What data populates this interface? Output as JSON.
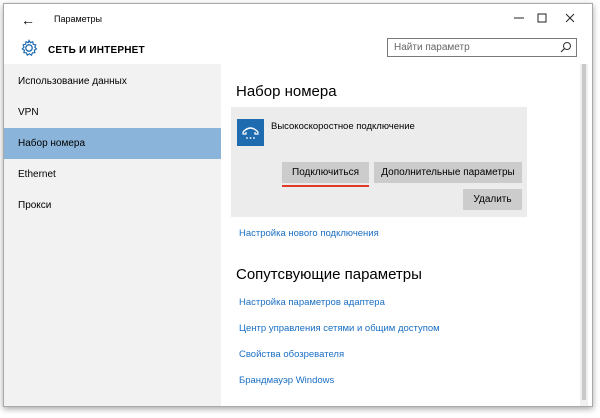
{
  "window": {
    "title": "Параметры",
    "back_glyph": "←",
    "minimize_glyph": "—",
    "maximize_glyph": "☐",
    "close_glyph": "✕"
  },
  "header": {
    "title": "СЕТЬ И ИНТЕРНЕТ",
    "search_placeholder": "Найти параметр"
  },
  "sidebar": {
    "items": [
      {
        "label": "Использование данных",
        "active": false
      },
      {
        "label": "VPN",
        "active": false
      },
      {
        "label": "Набор номера",
        "active": true
      },
      {
        "label": "Ethernet",
        "active": false
      },
      {
        "label": "Прокси",
        "active": false
      }
    ]
  },
  "main": {
    "title": "Набор номера",
    "connection": {
      "name": "Высокоскоростное подключение",
      "connect_label": "Подключиться",
      "advanced_label": "Дополнительные параметры",
      "delete_label": "Удалить"
    },
    "new_connection_link": "Настройка нового подключения",
    "related_title": "Сопутсвующие параметры",
    "related_links": [
      "Настройка параметров адаптера",
      "Центр управления сетями и общим доступом",
      "Свойства обозревателя",
      "Брандмауэр Windows"
    ]
  },
  "colors": {
    "accent": "#1f6bb0",
    "selection": "#8ab4d9",
    "link": "#1a6fc4",
    "highlight_underline": "#e03a2a"
  }
}
